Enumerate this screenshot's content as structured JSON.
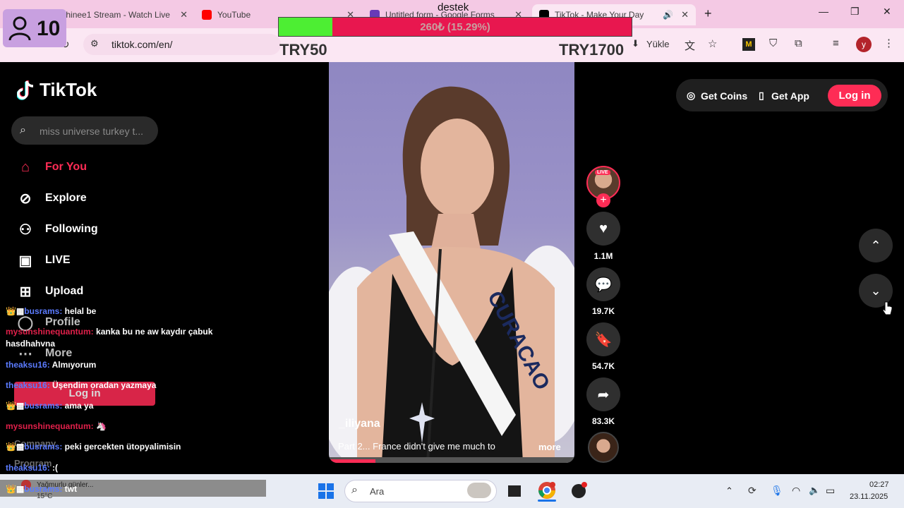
{
  "browser": {
    "tabs": [
      {
        "title": "sunshinee1 Stream - Watch Live",
        "favicon_color": "#6b3fa0"
      },
      {
        "title": "YouTube",
        "favicon_color": "#ff0000"
      },
      {
        "title": "Untitled form - Google Forms",
        "favicon_color": "#673ab7"
      },
      {
        "title": "TikTok - Make Your Day",
        "favicon_color": "#000000"
      }
    ],
    "new_tab": "+",
    "url": "tiktok.com/en/",
    "install_label": "Yükle",
    "profile_initial": "y",
    "window_controls": {
      "minimize": "—",
      "maximize": "❐",
      "close": "✕"
    }
  },
  "overlay": {
    "viewer_count": "10",
    "goal": {
      "title": "destek",
      "progress_text": "260₺ (15.29%)",
      "progress_fraction": 0.1529,
      "min_label": "TRY50",
      "max_label": "TRY1700"
    }
  },
  "tiktok": {
    "logo_text": "TikTok",
    "search_placeholder": "miss universe turkey t...",
    "nav": [
      {
        "label": "For You",
        "icon": "home-icon",
        "active": true
      },
      {
        "label": "Explore",
        "icon": "compass-icon"
      },
      {
        "label": "Following",
        "icon": "person-icon"
      },
      {
        "label": "LIVE",
        "icon": "live-tv-icon"
      },
      {
        "label": "Upload",
        "icon": "plus-square-icon"
      },
      {
        "label": "Profile",
        "icon": "profile-icon"
      },
      {
        "label": "More",
        "icon": "ellipsis-icon"
      }
    ],
    "sidebar_login": "Log in",
    "footer_links": [
      "Company",
      "Program"
    ],
    "topbar": {
      "get_coins": "Get Coins",
      "get_app": "Get App",
      "login": "Log in"
    },
    "video": {
      "author": "_iliyana",
      "caption": "Part 2... France didn't give me much to",
      "more": "more",
      "sash_text": "CURACAO",
      "live_badge": "LIVE"
    },
    "actions": [
      {
        "name": "like",
        "count": "1.1M"
      },
      {
        "name": "comment",
        "count": "19.7K"
      },
      {
        "name": "save",
        "count": "54.7K"
      },
      {
        "name": "share",
        "count": "83.3K"
      }
    ]
  },
  "chat": [
    {
      "user": "busrams:",
      "text": " helal be",
      "user_color": "blue"
    },
    {
      "user": "mysunshinequantum:",
      "text": " kanka bu ne aw kaydır çabuk hasdhahvna",
      "user_color": "red"
    },
    {
      "user": "theaksu16:",
      "text": " Almıyorum",
      "user_color": "blue"
    },
    {
      "user": "theaksu16:",
      "text": " Üşendim oradan yazmaya",
      "user_color": "blue"
    },
    {
      "user": "busrams:",
      "text": " ama ya",
      "user_color": "blue"
    },
    {
      "user": "mysunshinequantum:",
      "text": " 🦄",
      "user_color": "red"
    },
    {
      "user": "busrams:",
      "text": " peki gercekten ütopyalimisin",
      "user_color": "blue"
    },
    {
      "user": "theaksu16:",
      "text": " :(",
      "user_color": "blue"
    },
    {
      "user": "busrams:",
      "text": " twt",
      "user_color": "blue"
    }
  ],
  "taskbar": {
    "search_placeholder": "Ara",
    "weather_text": "Yağmurlu günler...",
    "weather_temp": "15°C",
    "time": "02:27",
    "date": "23.11.2025"
  }
}
